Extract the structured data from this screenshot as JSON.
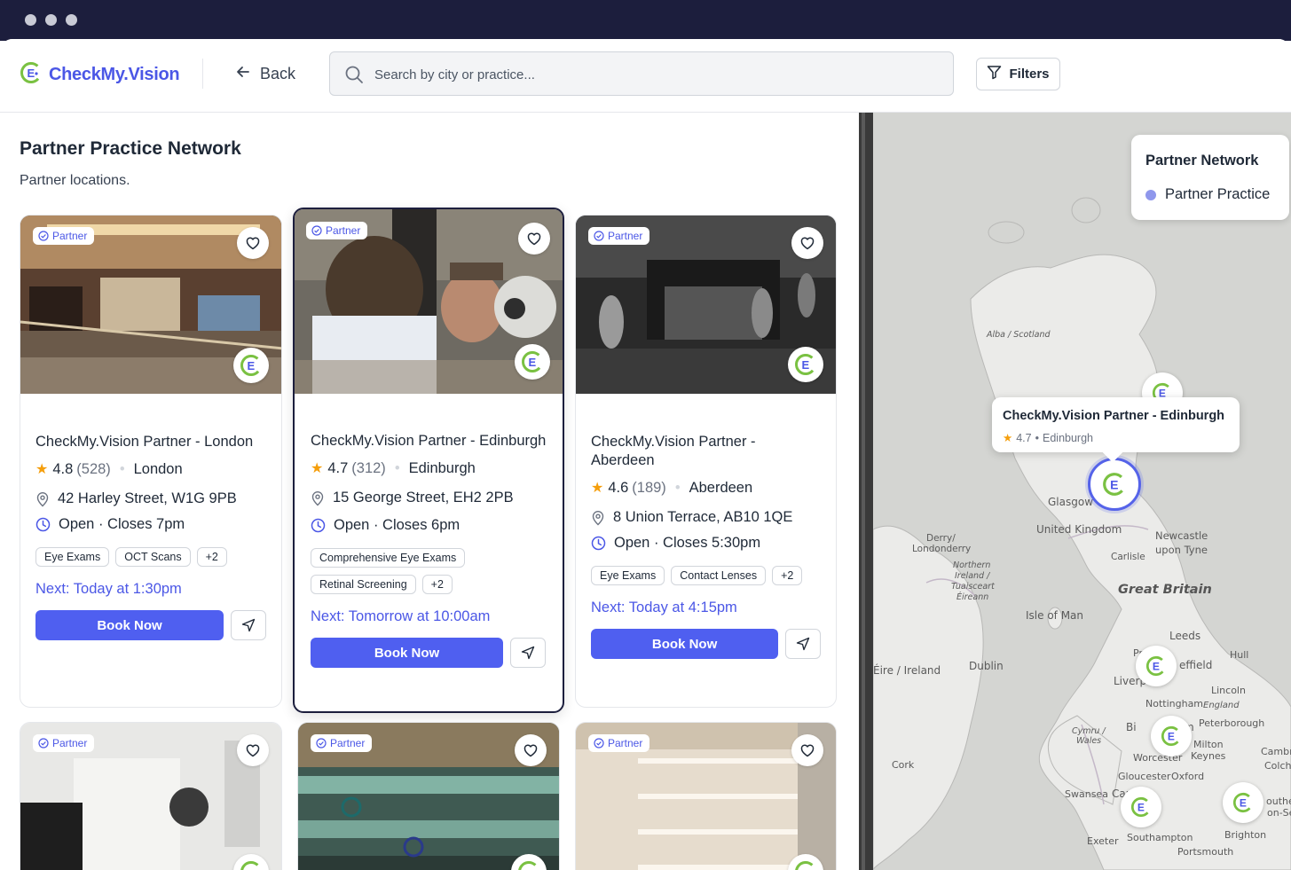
{
  "app": {
    "brand": "CheckMy.Vision",
    "back_label": "Back",
    "search_placeholder": "Search by city or practice...",
    "filters_label": "Filters"
  },
  "list": {
    "title": "Partner Practice Network",
    "subtitle": "Partner locations."
  },
  "cards": [
    {
      "badge": "Partner",
      "name": "CheckMy.Vision Partner - London",
      "rating": "4.8",
      "reviews": "(528)",
      "city": "London",
      "address": "42 Harley Street, W1G 9PB",
      "hours": "Open · Closes 7pm",
      "tags": [
        "Eye Exams",
        "OCT Scans",
        "+2"
      ],
      "next": "Next: Today at 1:30pm",
      "book": "Book Now"
    },
    {
      "badge": "Partner",
      "name": "CheckMy.Vision Partner - Edinburgh",
      "rating": "4.7",
      "reviews": "(312)",
      "city": "Edinburgh",
      "address": "15 George Street, EH2 2PB",
      "hours": "Open · Closes 6pm",
      "tags": [
        "Comprehensive Eye Exams",
        "Retinal Screening",
        "+2"
      ],
      "next": "Next: Tomorrow at 10:00am",
      "book": "Book Now"
    },
    {
      "badge": "Partner",
      "name": "CheckMy.Vision Partner - Aberdeen",
      "rating": "4.6",
      "reviews": "(189)",
      "city": "Aberdeen",
      "address": "8 Union Terrace, AB10 1QE",
      "hours": "Open · Closes 5:30pm",
      "tags": [
        "Eye Exams",
        "Contact Lenses",
        "+2"
      ],
      "next": "Next: Today at 4:15pm",
      "book": "Book Now"
    },
    {
      "badge": "Partner"
    },
    {
      "badge": "Partner"
    },
    {
      "badge": "Partner"
    }
  ],
  "map": {
    "legend_title": "Partner Network",
    "legend_item": "Partner Practice",
    "tooltip": {
      "title": "CheckMy.Vision Partner - Edinburgh",
      "rating": "4.7",
      "city": "Edinburgh"
    },
    "labels": {
      "alba": "Alba / Scotland",
      "glasgow": "Glasgow",
      "uk": "United Kingdom",
      "newcastle1": "Newcastle",
      "newcastle2": "upon Tyne",
      "carlisle": "Carlisle",
      "derry1": "Derry/",
      "derry2": "Londonderry",
      "ni1": "Northern",
      "ni2": "Ireland /",
      "ni3": "Tuaisceart",
      "ni4": "Éireann",
      "gb": "Great Britain",
      "iom": "Isle of Man",
      "leeds": "Leeds",
      "pres": "Pres",
      "effield": "effield",
      "hull": "Hull",
      "eire": "Éire / Ireland",
      "dublin": "Dublin",
      "liverpo": "Liverpo",
      "lincoln": "Lincoln",
      "nottingham": "Nottingham",
      "england": "England",
      "bi": "Bi",
      "m": "m",
      "peterborough": "Peterborough",
      "cymru1": "Cymru /",
      "cymru2": "Wales",
      "milton1": "Milton",
      "milton2": "Keynes",
      "cambri": "Cambri",
      "colche": "Colche",
      "cork": "Cork",
      "worcester": "Worcester",
      "gloucester": "Gloucester",
      "oxford": "Oxford",
      "swansea": "Swansea",
      "card": "Card",
      "outher": "outher",
      "onse": "on-Se",
      "exeter": "Exeter",
      "southampton": "Southampton",
      "brighton": "Brighton",
      "portsmouth": "Portsmouth"
    }
  },
  "colors": {
    "accent": "#4f5ff0",
    "chrome": "#1c1e3d",
    "star": "#f59e0b",
    "brand_green": "#7ac142"
  }
}
